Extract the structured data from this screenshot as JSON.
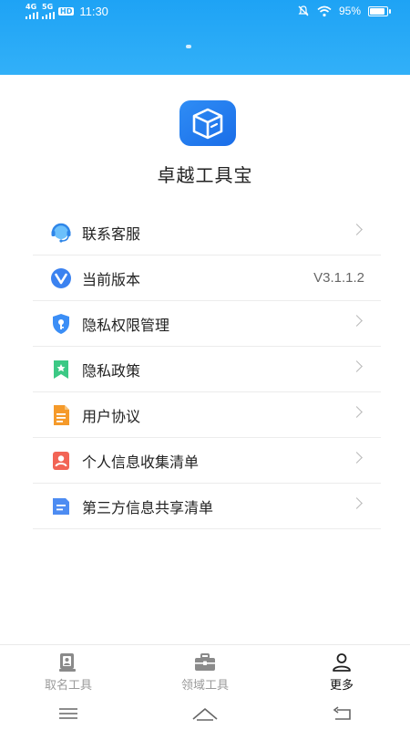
{
  "status_bar": {
    "signal1": "4G",
    "signal2": "5G",
    "hd": "HD",
    "time": "11:30",
    "battery_text": "95%",
    "battery_level": 0.95
  },
  "app": {
    "name": "卓越工具宝",
    "logo_icon": "box-icon"
  },
  "menu": {
    "items": [
      {
        "label": "联系客服",
        "icon": "customer-service-icon",
        "color": "#4aa6f2"
      },
      {
        "label": "当前版本",
        "icon": "version-icon",
        "color": "#3b82f0",
        "value": "V3.1.1.2"
      },
      {
        "label": "隐私权限管理",
        "icon": "privacy-shield-icon",
        "color": "#3b8ef6"
      },
      {
        "label": "隐私政策",
        "icon": "policy-bookmark-icon",
        "color": "#3cc985"
      },
      {
        "label": "用户协议",
        "icon": "agreement-doc-icon",
        "color": "#f59a2a"
      },
      {
        "label": "个人信息收集清单",
        "icon": "personal-info-icon",
        "color": "#f26455"
      },
      {
        "label": "第三方信息共享清单",
        "icon": "share-list-icon",
        "color": "#4d8cf2"
      }
    ]
  },
  "tabbar": {
    "tabs": [
      {
        "label": "取名工具",
        "icon": "naming-tool-icon"
      },
      {
        "label": "领域工具",
        "icon": "toolbox-icon"
      },
      {
        "label": "更多",
        "icon": "person-icon"
      }
    ],
    "active_index": 2
  },
  "colors": {
    "header": "#1ea3f5",
    "accent": "#2f8df5"
  }
}
